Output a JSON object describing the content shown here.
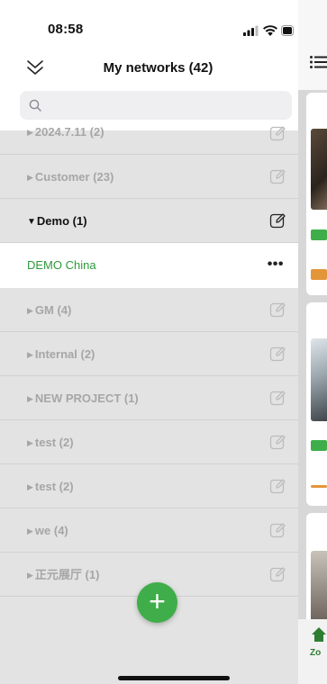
{
  "status_bar": {
    "time": "08:58"
  },
  "header": {
    "title": "My networks (42)"
  },
  "search": {
    "placeholder": ""
  },
  "groups": [
    {
      "label": "2024.7.11 (2)",
      "expanded": false
    },
    {
      "label": "Customer (23)",
      "expanded": false
    },
    {
      "label": "Demo (1)",
      "expanded": true,
      "children": [
        {
          "label": "DEMO China"
        }
      ]
    },
    {
      "label": "GM (4)",
      "expanded": false
    },
    {
      "label": "Internal (2)",
      "expanded": false
    },
    {
      "label": "NEW PROJECT (1)",
      "expanded": false
    },
    {
      "label": "test (2)",
      "expanded": false
    },
    {
      "label": "test (2)",
      "expanded": false
    },
    {
      "label": "we (4)",
      "expanded": false
    },
    {
      "label": "正元展厅 (1)",
      "expanded": false
    }
  ],
  "glyphs": {
    "collapsed_arrow": "▶",
    "expanded_arrow": "▼",
    "more": "•••",
    "add": "+"
  },
  "background_app": {
    "bottom_label": "Zo"
  },
  "colors": {
    "accent_green": "#3fae4a",
    "child_text": "#2e9a3c",
    "tag_orange": "#e3953a"
  },
  "icons": [
    "chevron-double-down-icon",
    "search-icon",
    "edit-icon",
    "more-icon",
    "plus-icon",
    "menu-icon",
    "home-icon",
    "signal-icon",
    "wifi-icon",
    "battery-icon"
  ]
}
